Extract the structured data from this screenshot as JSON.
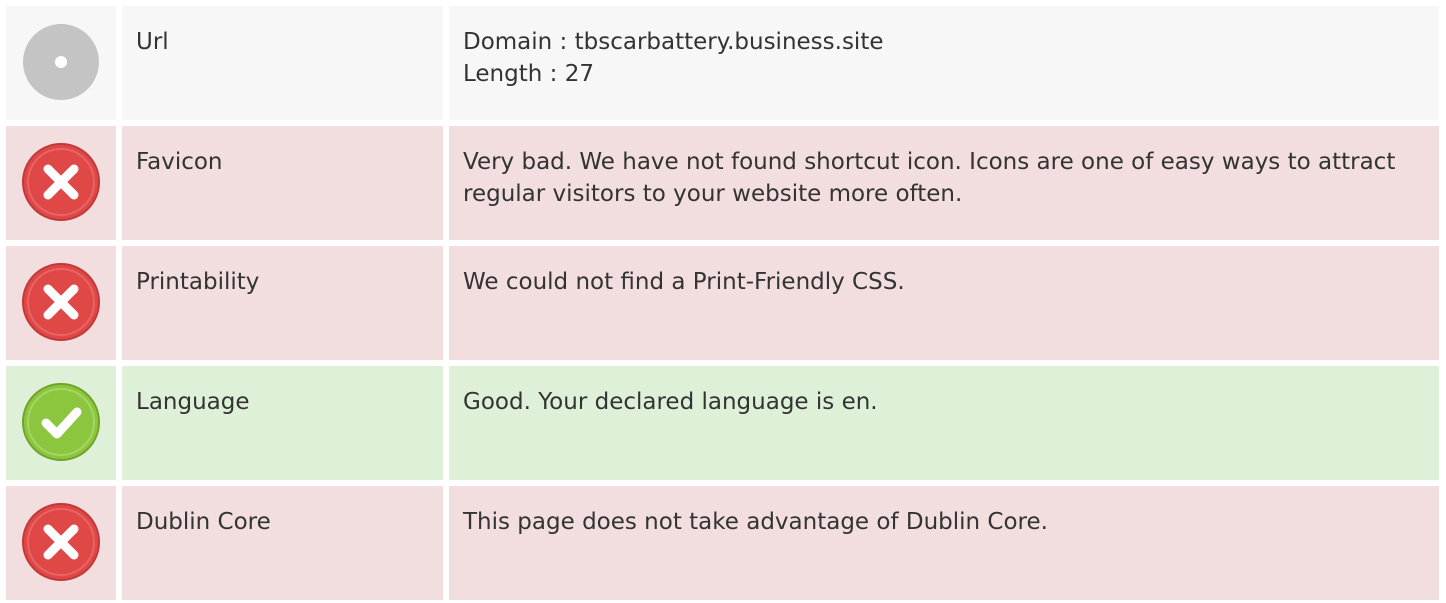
{
  "rows": [
    {
      "status": "neutral",
      "icon": "neutral-dot-icon",
      "label": "Url",
      "lines": [
        "Domain : tbscarbattery.business.site",
        "Length : 27"
      ]
    },
    {
      "status": "bad",
      "icon": "error-x-icon",
      "label": "Favicon",
      "lines": [
        "Very bad. We have not found shortcut icon. Icons are one of easy ways to attract regular visitors to your website more often."
      ]
    },
    {
      "status": "bad",
      "icon": "error-x-icon",
      "label": "Printability",
      "lines": [
        "We could not find a Print-Friendly CSS."
      ]
    },
    {
      "status": "good",
      "icon": "success-check-icon",
      "label": "Language",
      "lines": [
        "Good. Your declared language is en."
      ]
    },
    {
      "status": "bad",
      "icon": "error-x-icon",
      "label": "Dublin Core",
      "lines": [
        "This page does not take advantage of Dublin Core."
      ]
    }
  ],
  "colors": {
    "neutral_bg": "#f7f7f7",
    "bad_bg": "#f2dede",
    "good_bg": "#dff0d8",
    "error_icon": "#e04848",
    "success_icon": "#8cc63f",
    "neutral_icon": "#c4c4c4"
  }
}
